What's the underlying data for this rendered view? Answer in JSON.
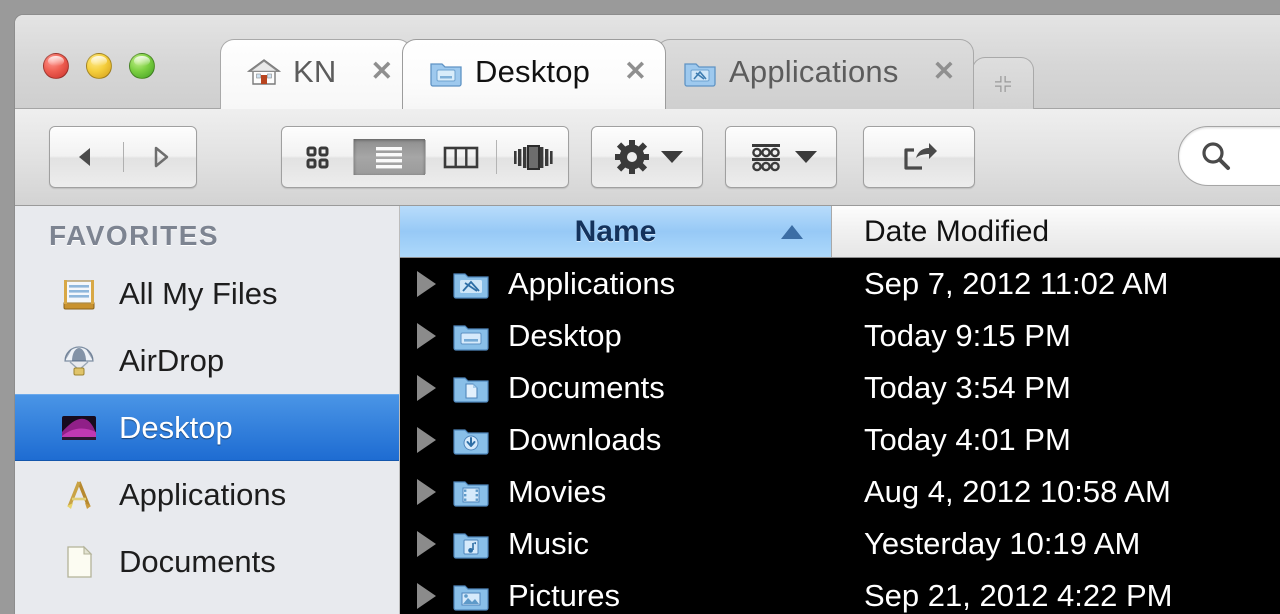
{
  "window": {
    "traffic_lights": [
      {
        "name": "close",
        "color": "#ef5f52"
      },
      {
        "name": "minimize",
        "color": "#f5cf3c"
      },
      {
        "name": "zoom",
        "color": "#7dd042"
      }
    ]
  },
  "tabs": {
    "items": [
      {
        "label": "KN",
        "icon": "house-icon",
        "active": false,
        "close_label": "✕"
      },
      {
        "label": "Desktop",
        "icon": "folder-icon",
        "active": true,
        "close_label": "✕"
      },
      {
        "label": "Applications",
        "icon": "applications-folder-icon",
        "active": false,
        "close_label": "✕"
      }
    ],
    "new_tab_label": "+"
  },
  "toolbar": {
    "back_label": "◀",
    "forward_label": "▶",
    "view_modes": [
      {
        "name": "icon-view",
        "selected": false
      },
      {
        "name": "list-view",
        "selected": true
      },
      {
        "name": "column-view",
        "selected": false
      },
      {
        "name": "coverflow-view",
        "selected": false
      }
    ],
    "action_menu": "gear-icon",
    "arrange_menu": "arrange-icon",
    "share": "share-icon",
    "search": {
      "placeholder": "",
      "value": "",
      "icon": "search-icon"
    }
  },
  "sidebar": {
    "header": "FAVORITES",
    "items": [
      {
        "label": "All My Files",
        "icon": "all-my-files-icon",
        "selected": false
      },
      {
        "label": "AirDrop",
        "icon": "airdrop-icon",
        "selected": false
      },
      {
        "label": "Desktop",
        "icon": "desktop-icon",
        "selected": true
      },
      {
        "label": "Applications",
        "icon": "applications-icon",
        "selected": false
      },
      {
        "label": "Documents",
        "icon": "documents-icon",
        "selected": false
      }
    ]
  },
  "filelist": {
    "columns": [
      {
        "label": "Name",
        "sorted": true,
        "sort_direction": "ascending"
      },
      {
        "label": "Date Modified",
        "sorted": false
      }
    ],
    "rows": [
      {
        "name": "Applications",
        "date_modified": "Sep 7, 2012 11:02 AM",
        "icon": "applications-folder-icon",
        "expandable": true
      },
      {
        "name": "Desktop",
        "date_modified": "Today 9:15 PM",
        "icon": "desktop-folder-icon",
        "expandable": true
      },
      {
        "name": "Documents",
        "date_modified": "Today 3:54 PM",
        "icon": "documents-folder-icon",
        "expandable": true
      },
      {
        "name": "Downloads",
        "date_modified": "Today 4:01 PM",
        "icon": "downloads-folder-icon",
        "expandable": true
      },
      {
        "name": "Movies",
        "date_modified": "Aug 4, 2012 10:58 AM",
        "icon": "movies-folder-icon",
        "expandable": true
      },
      {
        "name": "Music",
        "date_modified": "Yesterday 10:19 AM",
        "icon": "music-folder-icon",
        "expandable": true
      },
      {
        "name": "Pictures",
        "date_modified": "Sep 21, 2012 4:22 PM",
        "icon": "pictures-folder-icon",
        "expandable": true
      }
    ]
  },
  "colors": {
    "selection_blue": "#1e6cd2",
    "sorted_column_blue": "#97c9f6",
    "list_background": "#000000",
    "sidebar_background": "#e8eaee"
  }
}
